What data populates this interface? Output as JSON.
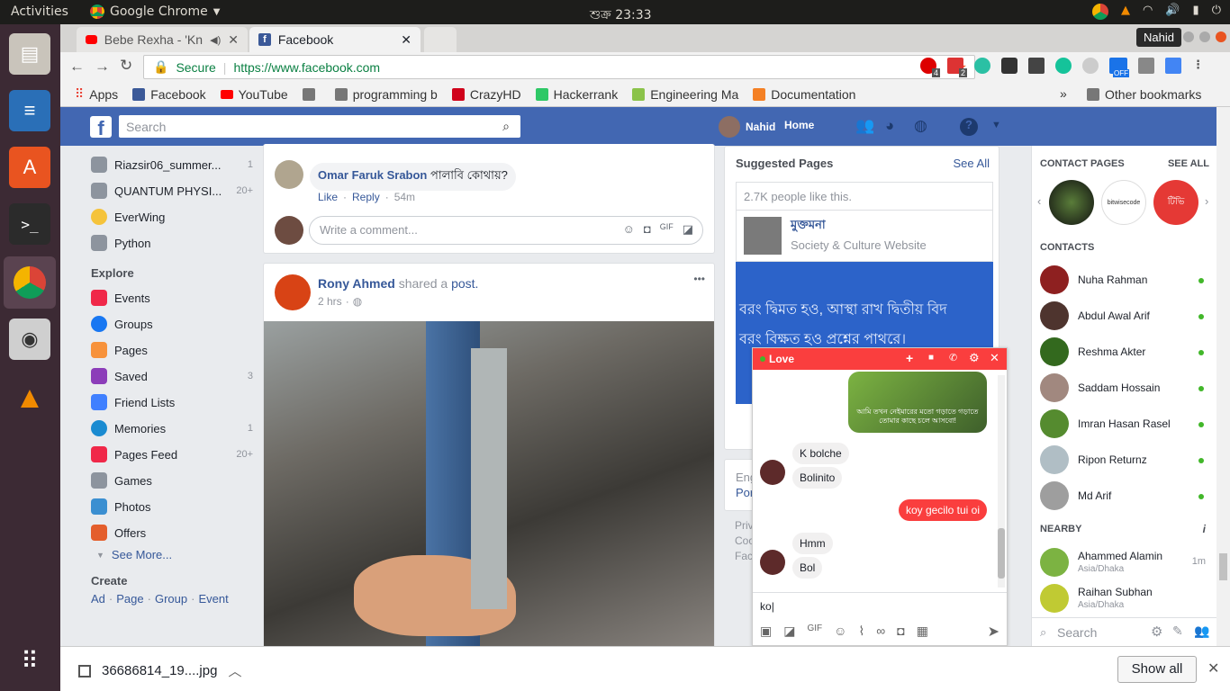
{
  "os": {
    "activities": "Activities",
    "app_name": "Google Chrome",
    "clock": "শুক্র 23:33"
  },
  "browser": {
    "tabs": [
      {
        "title": "Bebe Rexha - 'Kn",
        "favicon": "youtube-icon"
      },
      {
        "title": "Facebook",
        "favicon": "facebook-icon"
      }
    ],
    "profile": "Nahid",
    "secure_label": "Secure",
    "url": "https://www.facebook.com",
    "extension_badges": {
      "ext1": "4",
      "ext2": "2",
      "ext_off": "OFF"
    },
    "bookmarks": [
      "Apps",
      "Facebook",
      "YouTube",
      "",
      "programming b",
      "CrazyHD",
      "Hackerrank",
      "Engineering Ma",
      "Documentation"
    ],
    "bookmarks_more": "»",
    "other_bookmarks": "Other bookmarks"
  },
  "facebook": {
    "search_placeholder": "Search",
    "user_name": "Nahid",
    "home": "Home",
    "left_nav": {
      "groups": [
        {
          "label": "Riazsir06_summer...",
          "count": "1"
        },
        {
          "label": "QUANTUM PHYSI...",
          "count": "20+"
        },
        {
          "label": "EverWing",
          "count": ""
        },
        {
          "label": "Python",
          "count": ""
        }
      ],
      "explore_heading": "Explore",
      "explore": [
        {
          "label": "Events",
          "count": ""
        },
        {
          "label": "Groups",
          "count": ""
        },
        {
          "label": "Pages",
          "count": ""
        },
        {
          "label": "Saved",
          "count": "3"
        },
        {
          "label": "Friend Lists",
          "count": ""
        },
        {
          "label": "Memories",
          "count": "1"
        },
        {
          "label": "Pages Feed",
          "count": "20+"
        },
        {
          "label": "Games",
          "count": ""
        },
        {
          "label": "Photos",
          "count": ""
        },
        {
          "label": "Offers",
          "count": ""
        }
      ],
      "see_more": "See More...",
      "create_heading": "Create",
      "create_links": [
        "Ad",
        "Page",
        "Group",
        "Event"
      ]
    },
    "comment": {
      "author": "Omar Faruk Srabon",
      "text": "পালাবি কোথায়?",
      "like": "Like",
      "reply": "Reply",
      "time": "54m",
      "write_placeholder": "Write a comment..."
    },
    "post": {
      "author": "Rony Ahmed",
      "action": "shared a",
      "object": "post.",
      "time": "2 hrs",
      "more": "•••"
    },
    "suggested": {
      "heading": "Suggested Pages",
      "see_all": "See All",
      "likes": "2.7K people like this.",
      "page_name": "মুক্তমনা",
      "page_category": "Society & Culture Website",
      "banner_line1": "বরং দ্বিমত হও, আস্থা রাখ দ্বিতীয় বিদ",
      "banner_line2": "বরং বিক্ষত হও প্রশ্নের পাথরে।"
    },
    "right_partial": {
      "line1": "Eng",
      "line2": "Por",
      "line3": "Priv",
      "line4": "Coo",
      "line5": "Fac"
    },
    "chat": {
      "name": "Love",
      "messages": [
        {
          "dir": "in",
          "text": "K bolche"
        },
        {
          "dir": "in",
          "text": "Bolinito"
        },
        {
          "dir": "out",
          "text": "koy gecilo tui oi"
        },
        {
          "dir": "in",
          "text": "Hmm"
        },
        {
          "dir": "in",
          "text": "Bol"
        }
      ],
      "input_value": "ko",
      "image_caption": "আমি তখন নেইমারের মতো গড়াতে গড়াতে তোমার কাছে চলে আসবো!"
    },
    "sidebar": {
      "contact_pages": "CONTACT PAGES",
      "see_all": "SEE ALL",
      "page_thumb_texts": [
        "bitwisecode",
        "টিভি"
      ],
      "contacts_heading": "CONTACTS",
      "contacts": [
        "Nuha Rahman",
        "Abdul Awal Arif",
        "Reshma Akter",
        "Saddam Hossain",
        "Imran Hasan Rasel",
        "Ripon Returnz",
        "Md Arif"
      ],
      "nearby_heading": "NEARBY",
      "nearby": [
        {
          "name": "Ahammed Alamin",
          "location": "Asia/Dhaka",
          "time": "1m"
        },
        {
          "name": "Raihan Subhan",
          "location": "Asia/Dhaka",
          "time": ""
        }
      ],
      "search_placeholder": "Search"
    }
  },
  "download": {
    "file": "36686814_19....jpg",
    "show_all": "Show all"
  },
  "colors": {
    "fb_blue": "#4267b2",
    "chat_red": "#fa3e3e",
    "online_green": "#42b72a"
  }
}
